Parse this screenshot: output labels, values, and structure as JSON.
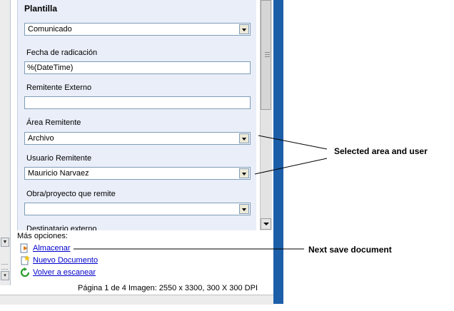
{
  "form": {
    "title": "Plantilla",
    "plantilla_value": "Comunicado",
    "fields": [
      {
        "label": "Fecha de radicación",
        "type": "text",
        "value": "%(DateTime)"
      },
      {
        "label": "Remitente Externo",
        "type": "text",
        "value": ""
      },
      {
        "label": "Área Remitente",
        "type": "select",
        "value": "Archivo"
      },
      {
        "label": "Usuario Remitente",
        "type": "select",
        "value": "Mauricio Narvaez"
      },
      {
        "label": "Obra/proyecto que remite",
        "type": "select",
        "value": ""
      },
      {
        "label": "Destinatario externo",
        "type": "text",
        "value": ""
      }
    ]
  },
  "options": {
    "heading": "Más opciones:",
    "items": [
      {
        "label": "Almacenar",
        "icon": "store-icon"
      },
      {
        "label": "Nuevo Documento",
        "icon": "new-document-icon"
      },
      {
        "label": "Volver a escanear",
        "icon": "rescan-icon"
      }
    ]
  },
  "status": {
    "page": "Página 1 de 4",
    "image_info": "Imagen: 2550 x 3300, 300 X 300 DPI"
  },
  "callouts": {
    "selected": "Selected area and user",
    "save": "Next save document"
  },
  "colors": {
    "panel_bg": "#e9eef8",
    "window_border": "#1c5ea8",
    "link": "#0000cc"
  }
}
